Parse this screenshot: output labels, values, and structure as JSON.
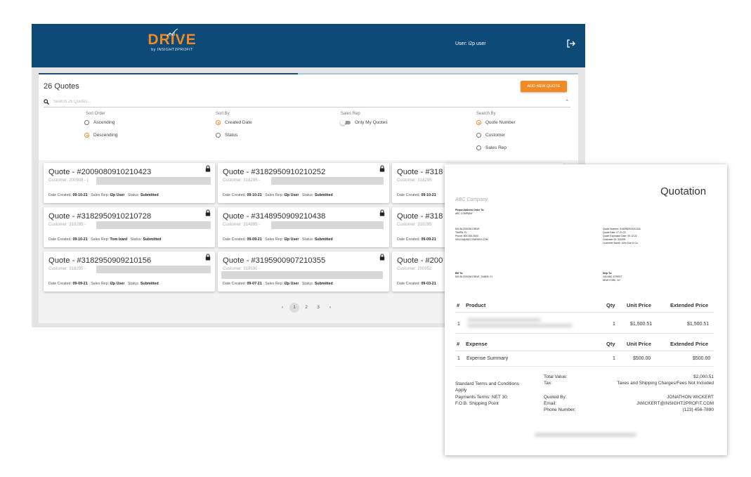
{
  "app": {
    "logo": {
      "brand": "DRIVE",
      "tagline": "by INSIGHT2PROFIT"
    },
    "user_label": "User: i2p user",
    "progress": 0.48,
    "title": "26 Quotes",
    "add_button": "ADD NEW QUOTE",
    "search_placeholder": "Search 26 Quotes...",
    "sort_order": {
      "label": "Sort Order",
      "options": [
        "Ascending",
        "Descending"
      ],
      "selected": "Descending"
    },
    "sort_by": {
      "label": "Sort By",
      "options": [
        "Created Date",
        "Status"
      ],
      "selected": "Created Date"
    },
    "sales_rep": {
      "label": "Sales Rep",
      "toggle": "Only My Quotes"
    },
    "search_by": {
      "label": "Search By",
      "options": [
        "Quote Number",
        "Customer",
        "Sales Rep"
      ],
      "selected": "Quote Number"
    },
    "meta_labels": {
      "created": "Date Created:",
      "rep": "Sales Rep:",
      "status": "Status:"
    },
    "cards": [
      {
        "quote": "Quote - #2009080910210423",
        "customer": "Customer: 200908 - (",
        "date": "09-10-21",
        "rep": "I2p User",
        "status": "Submitted"
      },
      {
        "quote": "Quote - #3182950910210252",
        "customer": "Customer: 318295 -",
        "date": "09-10-21",
        "rep": "I2p User",
        "status": "Submitted"
      },
      {
        "quote": "Quote - #318",
        "customer": "Customer: 318295",
        "date": "09-10-21",
        "rep": "",
        "status": ""
      },
      {
        "quote": "Quote - #3182950910210728",
        "customer": "Customer: 318295 -",
        "date": "09-10-21",
        "rep": "Tom Izard",
        "status": "Submitted"
      },
      {
        "quote": "Quote - #3148950909210438",
        "customer": "Customer: 314895 -",
        "date": "09-09-21",
        "rep": "I2p User",
        "status": "Submitted"
      },
      {
        "quote": "Quote - #318",
        "customer": "Customer: 318295",
        "date": "09-09-21",
        "rep": "",
        "status": ""
      },
      {
        "quote": "Quote - #3182950909210156",
        "customer": "Customer: 318295 -",
        "date": "09-09-21",
        "rep": "I2p User",
        "status": "Submitted"
      },
      {
        "quote": "Quote - #3195900907210355",
        "customer": "Customer: 319590 -",
        "date": "09-07-21",
        "rep": "I2p User",
        "status": "Submitted"
      },
      {
        "quote": "Quote - #200",
        "customer": "Customer: 200952",
        "date": "09-03-21",
        "rep": "",
        "status": ""
      }
    ],
    "pagination": {
      "prev": "‹",
      "pages": [
        "1",
        "2",
        "3"
      ],
      "current": "1",
      "next": "›"
    }
  },
  "doc": {
    "company": "ABC Company",
    "title": "Quotation",
    "please_address": "Please Address Order To:",
    "addr_company": "ABC COMPANY",
    "addr_street": "500 BLOSSOM DRIVE",
    "addr_city": "TAMPA, FL",
    "addr_phone": "Phone: 800-000-0000",
    "addr_email": "SALES@ABCCOMPANY.COM",
    "quote_number": "Quote Number: 3182950923211118",
    "quote_date": "Quote Date: 07-21-22",
    "expiration_date": "Quote Expiration Date: 09-12-22",
    "customer_id": "Customer ID: 318295",
    "customer_name": "Customer Name: John Doe & Co.",
    "bill_to_label": "Bill To:",
    "bill_to": "500 BLOSSOM DRIVE, TAMPA, FL",
    "ship_to_label": "Ship To:",
    "ship_to_1": "100 ABC STREET",
    "ship_to_2": "NEW YORK, NY",
    "product_header": {
      "num": "#",
      "name": "Product",
      "qty": "Qty",
      "unit": "Unit Price",
      "ext": "Extended Price"
    },
    "product_rows": [
      {
        "num": "1",
        "qty": "1",
        "unit": "$1,500.51",
        "ext": "$1,500.51"
      }
    ],
    "expense_header": {
      "num": "#",
      "name": "Expense",
      "qty": "Qty",
      "unit": "Unit Price",
      "ext": "Extended Price"
    },
    "expense_rows": [
      {
        "num": "1",
        "name": "Expense Summary",
        "qty": "1",
        "unit": "$500.00",
        "ext": "$500.00"
      }
    ],
    "terms_1": "Standard Terms and Conditions",
    "terms_2": "Apply",
    "payment_terms": "Payments Terms: NET 30",
    "fob": "F.O.B. Shipping Point",
    "total_value_label": "Total Value:",
    "total_value": "$2,000.51",
    "tax_label": "Tax:",
    "tax_value": "Taxes and Shipping Charges/Fees Not Included",
    "quoted_by_label": "Quoted By:",
    "quoted_by": "JONATHON WICKERT",
    "email_label": "Email:",
    "email": "JWICKERT@INSIGHT2PROFIT.COM",
    "phone_label": "Phone Number:",
    "phone": "(123) 456-7890"
  },
  "colors": {
    "header": "#0e4a78",
    "accent": "#f08a24",
    "progress_track": "#a9c6df",
    "progress_fill": "#1b4f7e"
  },
  "icons": [
    "logo-chart-icon",
    "logout-icon",
    "search-icon",
    "chevron-up-icon",
    "lock-icon",
    "chevron-left-icon",
    "chevron-right-icon"
  ]
}
